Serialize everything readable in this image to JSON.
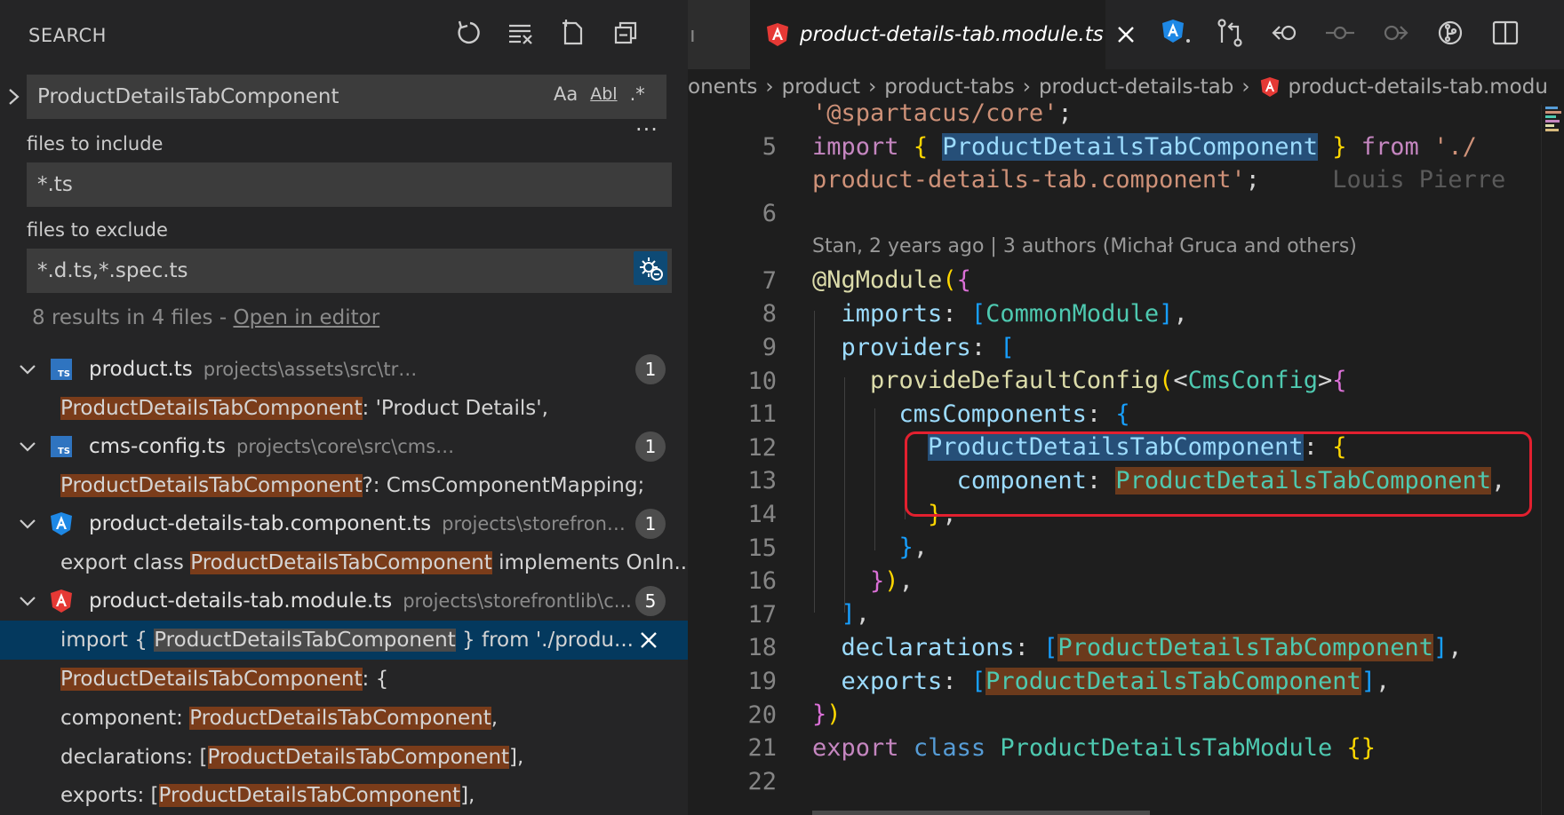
{
  "sidebar": {
    "title": "SEARCH",
    "actions": [
      "refresh-icon",
      "clear-results-icon",
      "new-search-editor-icon",
      "collapse-all-icon"
    ],
    "search": {
      "value": "ProductDetailsTabComponent",
      "options": {
        "match_case": "Aa",
        "whole_word": "Abl",
        "regex": ".*"
      }
    },
    "more": "···",
    "include": {
      "label": "files to include",
      "value": "*.ts"
    },
    "exclude": {
      "label": "files to exclude",
      "value": "*.d.ts,*.spec.ts"
    },
    "summary": {
      "text": "8 results in 4 files - ",
      "link": "Open in editor"
    },
    "files": [
      {
        "name": "product.ts",
        "path": "projects\\assets\\src\\translations\\en",
        "count": "1",
        "icon": "ts",
        "matches": [
          {
            "hl": "ProductDetailsTabComponent",
            "after": ": 'Product Details',"
          }
        ]
      },
      {
        "name": "cms-config.ts",
        "path": "projects\\core\\src\\cms\\config",
        "count": "1",
        "icon": "ts",
        "matches": [
          {
            "hl": "ProductDetailsTabComponent",
            "after": "?: CmsComponentMapping;"
          }
        ]
      },
      {
        "name": "product-details-tab.component.ts",
        "path": "projects\\storefrontli...",
        "count": "1",
        "icon": "angular-blue",
        "matches": [
          {
            "before": "export class ",
            "hl": "ProductDetailsTabComponent",
            "after": " implements OnIn..."
          }
        ]
      },
      {
        "name": "product-details-tab.module.ts",
        "path": "projects\\storefrontlib\\c...",
        "count": "5",
        "icon": "angular-red",
        "matches": [
          {
            "before": "import { ",
            "hl": "ProductDetailsTabComponent",
            "after": " } from './produ..."
          },
          {
            "hl": "ProductDetailsTabComponent",
            "after": ": {"
          },
          {
            "before": "component: ",
            "hl": "ProductDetailsTabComponent",
            "after": ","
          },
          {
            "before": "declarations: [",
            "hl": "ProductDetailsTabComponent",
            "after": "],"
          },
          {
            "before": "exports: [",
            "hl": "ProductDetailsTabComponent",
            "after": "],"
          }
        ]
      }
    ]
  },
  "editor": {
    "prev_tab": "ı",
    "active_tab": "product-details-tab.module.ts",
    "breadcrumb": [
      "onents",
      "product",
      "product-tabs",
      "product-details-tab",
      "product-details-tab.modu"
    ],
    "codelens": "Stan, 2 years ago | 3 authors (Michał Gruca and others)",
    "blame": "Louis Pierre",
    "line_numbers": [
      "5",
      "6",
      "7",
      "8",
      "9",
      "10",
      "11",
      "12",
      "13",
      "14",
      "15",
      "16",
      "17",
      "18",
      "19",
      "20",
      "21",
      "22"
    ],
    "code": {
      "l4": "'@spartacus/core'",
      "l5a": "import",
      "l5b": "ProductDetailsTabComponent",
      "l5c": "from",
      "l5d": "'./",
      "l5e": "product-details-tab.component'",
      "l7a": "@NgModule",
      "l8a": "imports",
      "l8b": "CommonModule",
      "l9a": "providers",
      "l10a": "provideDefaultConfig",
      "l10b": "CmsConfig",
      "l11a": "cmsComponents",
      "l12a": "ProductDetailsTabComponent",
      "l13a": "component",
      "l13b": "ProductDetailsTabComponent",
      "l18a": "declarations",
      "l18b": "ProductDetailsTabComponent",
      "l19a": "exports",
      "l19b": "ProductDetailsTabComponent",
      "l21a": "export",
      "l21b": "class",
      "l21c": "ProductDetailsTabModule"
    }
  }
}
